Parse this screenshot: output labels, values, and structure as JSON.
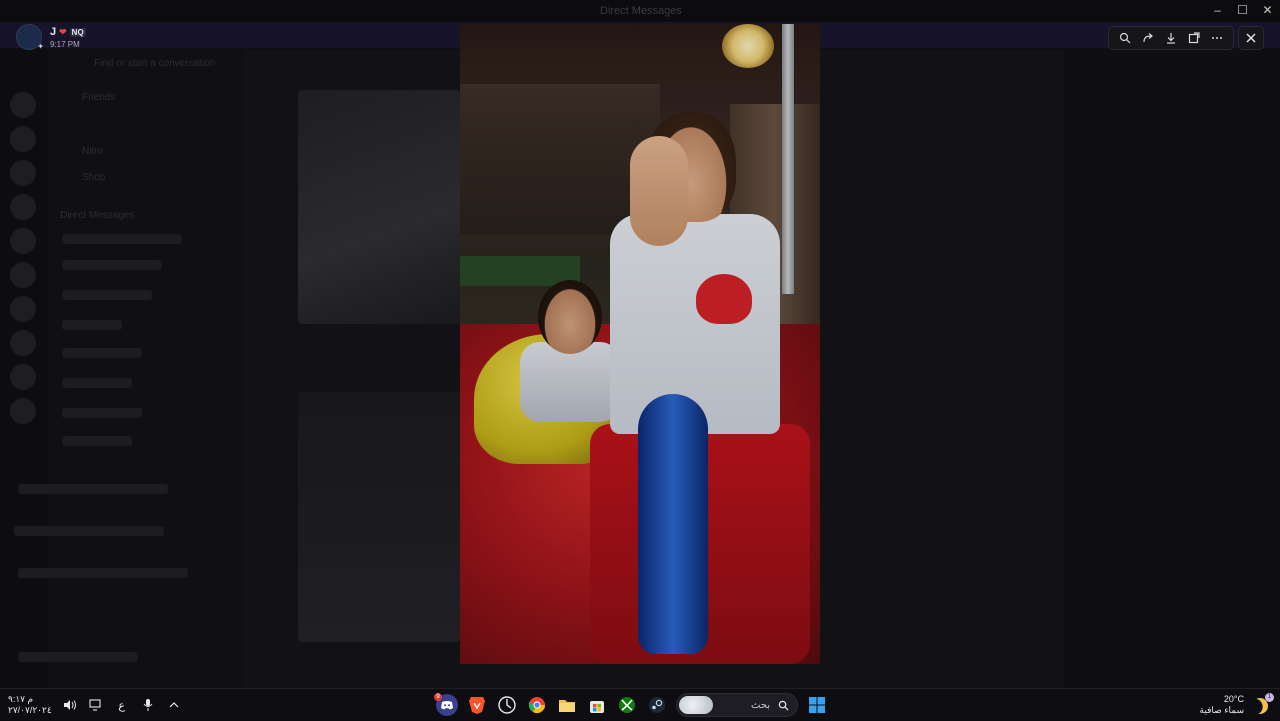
{
  "window": {
    "title": "Direct Messages"
  },
  "user": {
    "name": "J",
    "tag": "NQ",
    "time": "9:17 PM"
  },
  "viewer_toolbar": {
    "buttons": [
      "zoom-icon",
      "forward-icon",
      "download-icon",
      "open-external-icon",
      "more-icon"
    ],
    "close": "close-icon"
  },
  "taskbar": {
    "clock_time": "م ٩:١٧",
    "clock_date": "٢٧/٠٧/٢٠٢٤",
    "language": "ع",
    "search_label": "بحث",
    "weather_temp": "20°C",
    "weather_desc": "سماء صافية",
    "weather_badge": "1",
    "discord_badge": "9"
  },
  "background_dim_labels": {
    "find_conversation": "Find or start a conversation",
    "friends": "Friends",
    "nitro": "Nitro",
    "shop": "Shop",
    "direct_messages": "Direct Messages"
  },
  "colors": {
    "discord_blurple": "#5865f2",
    "brave_orange": "#fb542b",
    "chrome_yellow": "#fbbc04",
    "xbox_green": "#107c10"
  }
}
